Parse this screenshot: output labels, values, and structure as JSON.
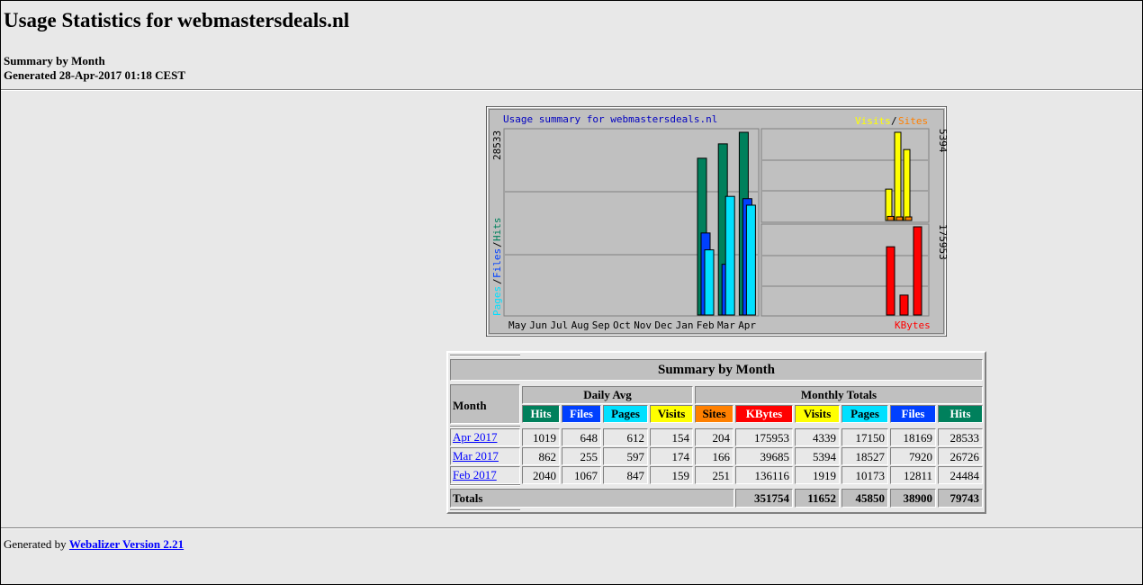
{
  "page": {
    "title": "Usage Statistics for webmastersdeals.nl",
    "summary_label": "Summary by Month",
    "generated_text": "Generated 28-Apr-2017 01:18 CEST"
  },
  "graph": {
    "title": "Usage summary for webmastersdeals.nl",
    "legend_visits": "Visits",
    "legend_slash": "/",
    "legend_sites": "Sites",
    "left_axis_label_pages": "Pages",
    "left_axis_label_files": "Files",
    "left_axis_label_hits": "Hits",
    "left_max": "28533",
    "right_top_max": "5394",
    "right_bottom_max": "175953",
    "kbytes_label": "KBytes",
    "months": [
      "May",
      "Jun",
      "Jul",
      "Aug",
      "Sep",
      "Oct",
      "Nov",
      "Dec",
      "Jan",
      "Feb",
      "Mar",
      "Apr"
    ],
    "colors": {
      "hits": "#00805c",
      "files": "#0040ff",
      "pages": "#00e0ff",
      "visits": "#ffff00",
      "sites": "#ff8000",
      "kbytes": "#ff0000"
    }
  },
  "chart_data": {
    "type": "bar",
    "categories": [
      "May",
      "Jun",
      "Jul",
      "Aug",
      "Sep",
      "Oct",
      "Nov",
      "Dec",
      "Jan",
      "Feb",
      "Mar",
      "Apr"
    ],
    "title": "Usage summary for webmastersdeals.nl",
    "series": [
      {
        "name": "Hits",
        "values": [
          0,
          0,
          0,
          0,
          0,
          0,
          0,
          0,
          0,
          24484,
          26726,
          28533
        ]
      },
      {
        "name": "Files",
        "values": [
          0,
          0,
          0,
          0,
          0,
          0,
          0,
          0,
          0,
          12811,
          7920,
          18169
        ]
      },
      {
        "name": "Pages",
        "values": [
          0,
          0,
          0,
          0,
          0,
          0,
          0,
          0,
          0,
          10173,
          18527,
          17150
        ]
      },
      {
        "name": "Visits",
        "values": [
          0,
          0,
          0,
          0,
          0,
          0,
          0,
          0,
          0,
          1919,
          5394,
          4339
        ]
      },
      {
        "name": "Sites",
        "values": [
          0,
          0,
          0,
          0,
          0,
          0,
          0,
          0,
          0,
          251,
          166,
          204
        ]
      },
      {
        "name": "KBytes",
        "values": [
          0,
          0,
          0,
          0,
          0,
          0,
          0,
          0,
          0,
          136116,
          39685,
          175953
        ]
      }
    ]
  },
  "table": {
    "caption": "Summary by Month",
    "month_header": "Month",
    "daily_avg_header": "Daily Avg",
    "monthly_totals_header": "Monthly Totals",
    "columns": [
      "Hits",
      "Files",
      "Pages",
      "Visits",
      "Sites",
      "KBytes",
      "Visits",
      "Pages",
      "Files",
      "Hits"
    ],
    "rows": [
      {
        "month": "Apr 2017",
        "values": [
          "1019",
          "648",
          "612",
          "154",
          "204",
          "175953",
          "4339",
          "17150",
          "18169",
          "28533"
        ]
      },
      {
        "month": "Mar 2017",
        "values": [
          "862",
          "255",
          "597",
          "174",
          "166",
          "39685",
          "5394",
          "18527",
          "7920",
          "26726"
        ]
      },
      {
        "month": "Feb 2017",
        "values": [
          "2040",
          "1067",
          "847",
          "159",
          "251",
          "136116",
          "1919",
          "10173",
          "12811",
          "24484"
        ]
      }
    ],
    "totals_label": "Totals",
    "totals": [
      "351754",
      "11652",
      "45850",
      "38900",
      "79743"
    ]
  },
  "footer": {
    "prefix": "Generated by",
    "link_text": "Webalizer Version 2.21"
  }
}
